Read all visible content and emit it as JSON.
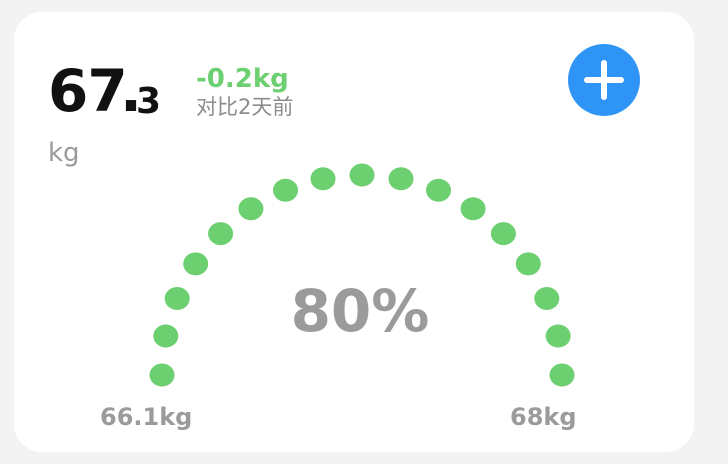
{
  "weight": {
    "integer": "67",
    "separator": ".",
    "decimal": "3",
    "unit": "kg"
  },
  "change": {
    "delta": "-0.2kg",
    "compare_text": "对比2天前"
  },
  "actions": {
    "add_icon": "plus-icon"
  },
  "gauge": {
    "percent_text": "80%",
    "percent_value": 80,
    "min_label": "66.1kg",
    "max_label": "68kg",
    "dot_color": "#6ccf70"
  },
  "colors": {
    "accent": "#2e95f7",
    "positive": "#6ccf70",
    "muted": "#9b9b9b"
  }
}
